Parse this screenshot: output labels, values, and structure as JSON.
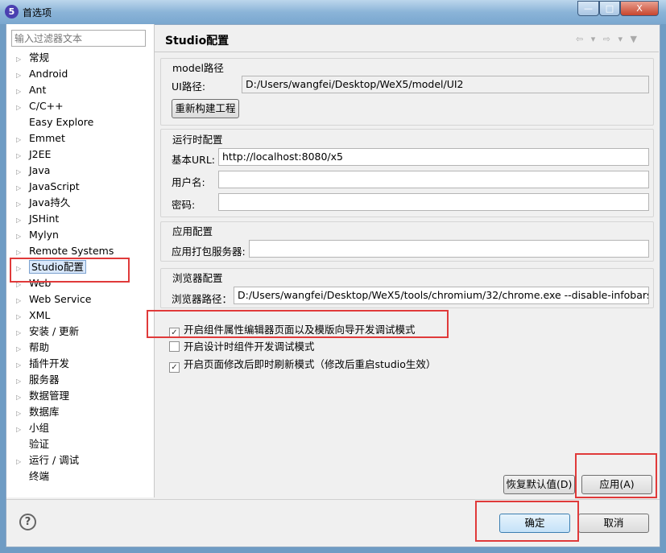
{
  "window": {
    "title": "首选项",
    "app_icon": "5",
    "minimize": "—",
    "maximize": "□",
    "close": "X"
  },
  "sidebar": {
    "filter_placeholder": "输入过滤器文本",
    "items": [
      {
        "label": "常规",
        "expandable": true
      },
      {
        "label": "Android",
        "expandable": true
      },
      {
        "label": "Ant",
        "expandable": true
      },
      {
        "label": "C/C++",
        "expandable": true
      },
      {
        "label": "Easy Explore",
        "expandable": false
      },
      {
        "label": "Emmet",
        "expandable": true
      },
      {
        "label": "J2EE",
        "expandable": true
      },
      {
        "label": "Java",
        "expandable": true
      },
      {
        "label": "JavaScript",
        "expandable": true
      },
      {
        "label": "Java持久",
        "expandable": true
      },
      {
        "label": "JSHint",
        "expandable": true
      },
      {
        "label": "Mylyn",
        "expandable": true
      },
      {
        "label": "Remote Systems",
        "expandable": true
      },
      {
        "label": "Studio配置",
        "expandable": true,
        "selected": true
      },
      {
        "label": "Web",
        "expandable": true
      },
      {
        "label": "Web Service",
        "expandable": true
      },
      {
        "label": "XML",
        "expandable": true
      },
      {
        "label": "安装 / 更新",
        "expandable": true
      },
      {
        "label": "帮助",
        "expandable": true
      },
      {
        "label": "插件开发",
        "expandable": true
      },
      {
        "label": "服务器",
        "expandable": true
      },
      {
        "label": "数据管理",
        "expandable": true
      },
      {
        "label": "数据库",
        "expandable": true
      },
      {
        "label": "小组",
        "expandable": true
      },
      {
        "label": "验证",
        "expandable": false
      },
      {
        "label": "运行 / 调试",
        "expandable": true
      },
      {
        "label": "终端",
        "expandable": false
      }
    ]
  },
  "page": {
    "title": "Studio配置",
    "nav_icons": "⇦ ▾ ⇨ ▾ ▼",
    "model_group": {
      "label": "model路径",
      "ui_path_label": "UI路径:",
      "ui_path_value": "D:/Users/wangfei/Desktop/WeX5/model/UI2",
      "rebuild_button": "重新构建工程"
    },
    "runtime_group": {
      "label": "运行时配置",
      "base_url_label": "基本URL:",
      "base_url_value": "http://localhost:8080/x5",
      "username_label": "用户名:",
      "username_value": "",
      "password_label": "密码:",
      "password_value": ""
    },
    "app_group": {
      "label": "应用配置",
      "pack_server_label": "应用打包服务器:",
      "pack_server_value": ""
    },
    "browser_group": {
      "label": "浏览器配置",
      "browser_path_label": "浏览器路径：",
      "browser_path_value": "D:/Users/wangfei/Desktop/WeX5/tools/chromium/32/chrome.exe --disable-infobars"
    },
    "checkboxes": [
      {
        "label": "开启组件属性编辑器页面以及模版向导开发调试模式",
        "checked": true
      },
      {
        "label": "开启设计时组件开发调试模式",
        "checked": false
      },
      {
        "label": "开启页面修改后即时刷新模式（修改后重启studio生效）",
        "checked": true
      }
    ],
    "restore_defaults": "恢复默认值(D)",
    "apply": "应用(A)"
  },
  "footer": {
    "help": "?",
    "ok": "确定",
    "cancel": "取消"
  },
  "colors": {
    "highlight": "#e03a3a"
  }
}
